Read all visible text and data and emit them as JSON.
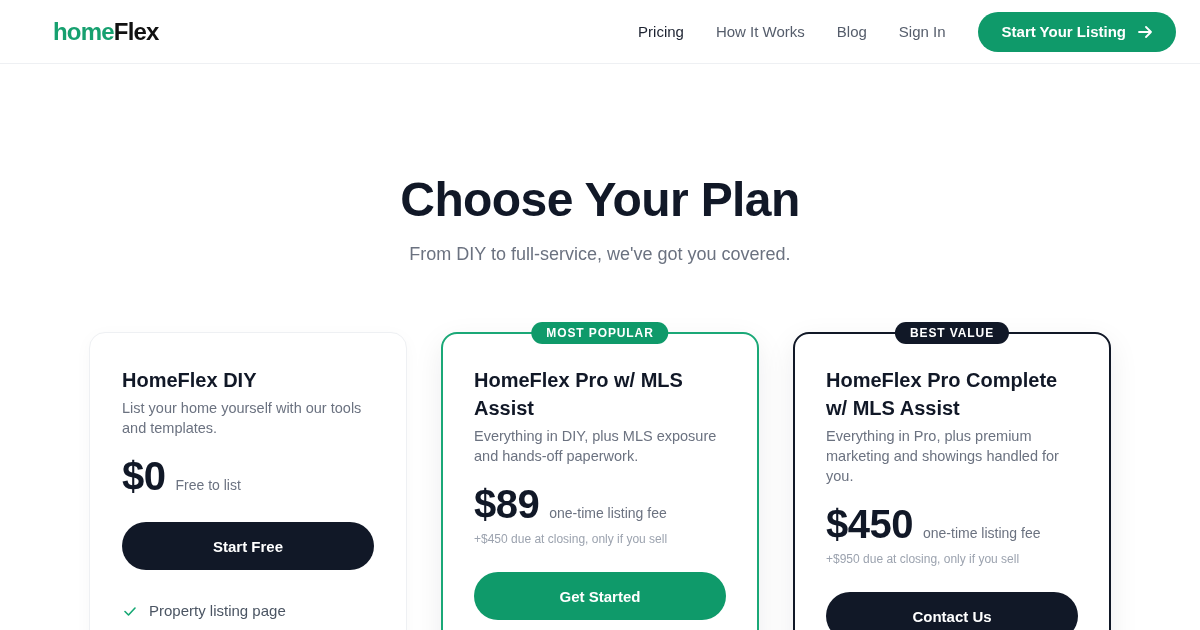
{
  "header": {
    "logo": {
      "prefix": "home",
      "suffix": "Flex"
    },
    "nav": [
      {
        "label": "Pricing",
        "selected": true
      },
      {
        "label": "How It Works",
        "selected": false
      },
      {
        "label": "Blog",
        "selected": false
      },
      {
        "label": "Sign In",
        "selected": false
      }
    ],
    "cta": {
      "label": "Start Your Listing"
    }
  },
  "hero": {
    "title": "Choose Your Plan",
    "subtitle": "From DIY to full-service, we've got you covered."
  },
  "plans": [
    {
      "kind": "basic",
      "name": "HomeFlex DIY",
      "description": "List your home yourself with our tools and templates.",
      "price": "$0",
      "price_note": "Free to list",
      "button": "Start Free",
      "features": [
        "Property listing page"
      ]
    },
    {
      "kind": "popular",
      "badge": "MOST POPULAR",
      "name": "HomeFlex Pro w/ MLS Assist",
      "description": "Everything in DIY, plus MLS exposure and hands-off paperwork.",
      "price": "$89",
      "price_note": "one-time listing fee",
      "closing_note": "+$450 due at closing, only if you sell",
      "button": "Get Started"
    },
    {
      "kind": "value",
      "badge": "BEST VALUE",
      "name": "HomeFlex Pro Complete w/ MLS Assist",
      "description": "Everything in Pro, plus premium marketing and showings handled for you.",
      "price": "$450",
      "price_note": "one-time listing fee",
      "closing_note": "+$950 due at closing, only if you sell",
      "button": "Contact Us"
    }
  ]
}
